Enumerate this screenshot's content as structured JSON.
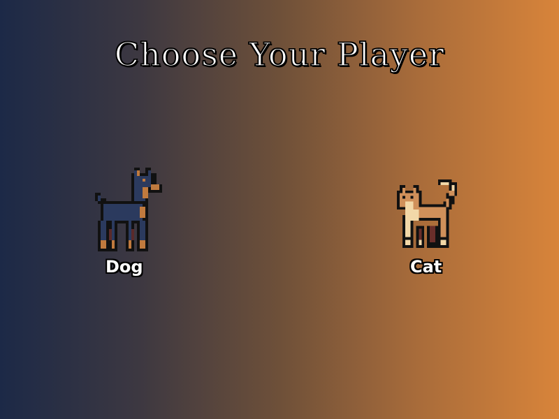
{
  "screen": {
    "title": "Choose Your Player"
  },
  "characters": [
    {
      "label": "Dog",
      "sprite": "doberman-sprite"
    },
    {
      "label": "Cat",
      "sprite": "orange-cat-sprite"
    }
  ],
  "colors": {
    "background_left": "#1c2947",
    "background_right": "#d8843a",
    "title_text": "#ffffff",
    "title_outline": "#000000"
  }
}
